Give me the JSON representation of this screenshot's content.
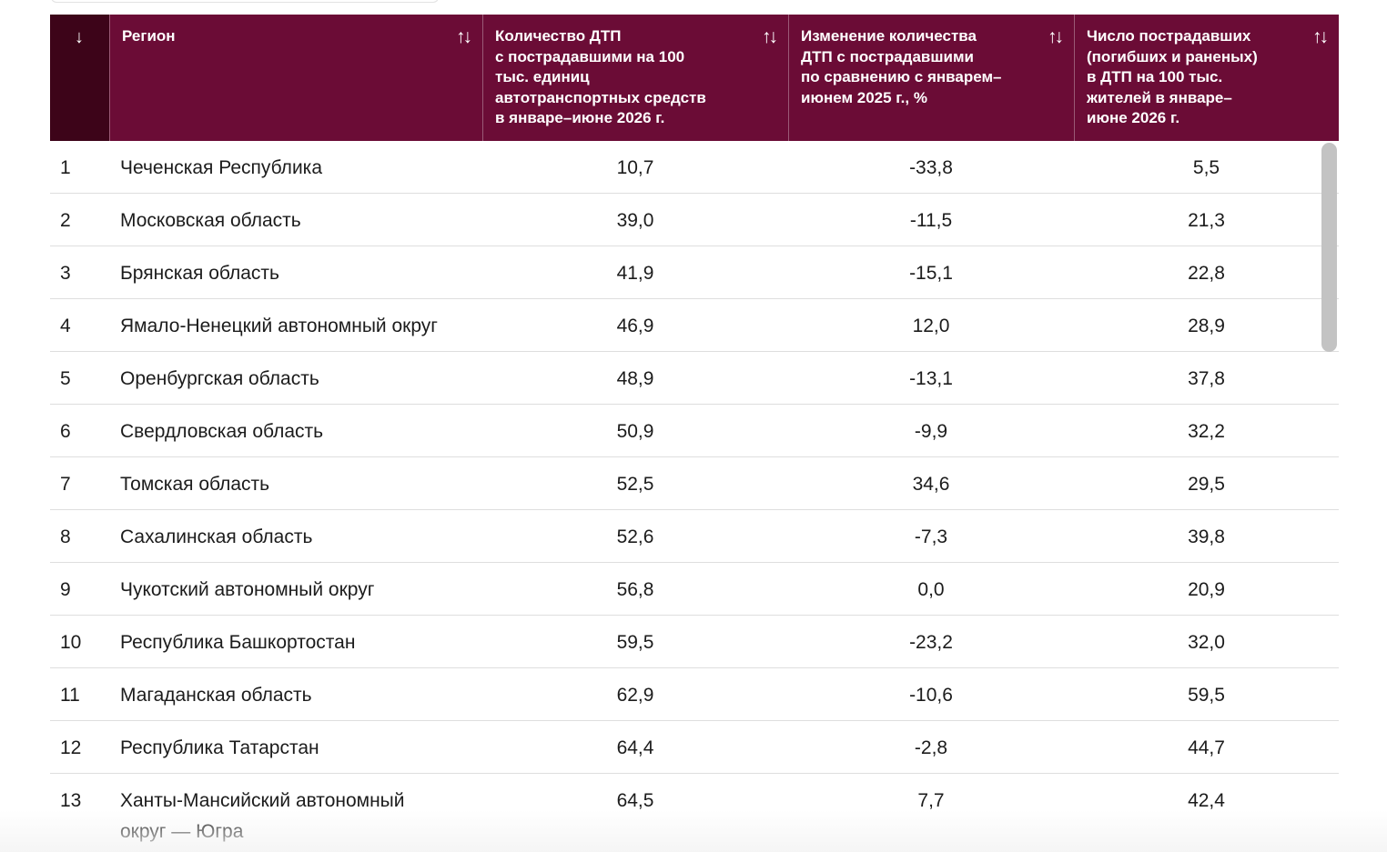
{
  "table": {
    "headers": {
      "num_sort_icon": "↓",
      "region": "Регион",
      "col_a": "Количество ДТП\nс пострадавшими на 100\nтыс. единиц\nавтотранспортных средств\nв январе–июне 2026 г.",
      "col_b": "Изменение количества\nДТП с пострадавшими\nпо сравнению с январем–\nиюнем 2025 г., %",
      "col_c": "Число пострадавших\n(погибших и раненых)\nв ДТП на 100 тыс.\nжителей в январе–\nиюне 2026 г.",
      "sort_icon": "↑↓"
    },
    "rows": [
      {
        "num": "1",
        "region": "Чеченская Республика",
        "a": "10,7",
        "b": "-33,8",
        "c": "5,5"
      },
      {
        "num": "2",
        "region": "Московская область",
        "a": "39,0",
        "b": "-11,5",
        "c": "21,3"
      },
      {
        "num": "3",
        "region": "Брянская область",
        "a": "41,9",
        "b": "-15,1",
        "c": "22,8"
      },
      {
        "num": "4",
        "region": "Ямало-Ненецкий автономный округ",
        "a": "46,9",
        "b": "12,0",
        "c": "28,9"
      },
      {
        "num": "5",
        "region": "Оренбургская область",
        "a": "48,9",
        "b": "-13,1",
        "c": "37,8"
      },
      {
        "num": "6",
        "region": "Свердловская область",
        "a": "50,9",
        "b": "-9,9",
        "c": "32,2"
      },
      {
        "num": "7",
        "region": "Томская область",
        "a": "52,5",
        "b": "34,6",
        "c": "29,5"
      },
      {
        "num": "8",
        "region": "Сахалинская область",
        "a": "52,6",
        "b": "-7,3",
        "c": "39,8"
      },
      {
        "num": "9",
        "region": "Чукотский автономный округ",
        "a": "56,8",
        "b": "0,0",
        "c": "20,9"
      },
      {
        "num": "10",
        "region": "Республика Башкортостан",
        "a": "59,5",
        "b": "-23,2",
        "c": "32,0"
      },
      {
        "num": "11",
        "region": "Магаданская область",
        "a": "62,9",
        "b": "-10,6",
        "c": "59,5"
      },
      {
        "num": "12",
        "region": "Республика Татарстан",
        "a": "64,4",
        "b": "-2,8",
        "c": "44,7"
      },
      {
        "num": "13",
        "region": "Ханты-Мансийский автономный\nокруг — Югра",
        "a": "64,5",
        "b": "7,7",
        "c": "42,4"
      }
    ]
  },
  "colors": {
    "header_bg": "#6b0c36",
    "header_num_bg": "#3d0419",
    "header_text": "#ffffff",
    "row_divider": "#dedede",
    "scrollbar": "#c3c3c3"
  },
  "icons": {
    "num_sort": "arrow-down-icon",
    "column_sort": "sort-up-down-icon"
  }
}
